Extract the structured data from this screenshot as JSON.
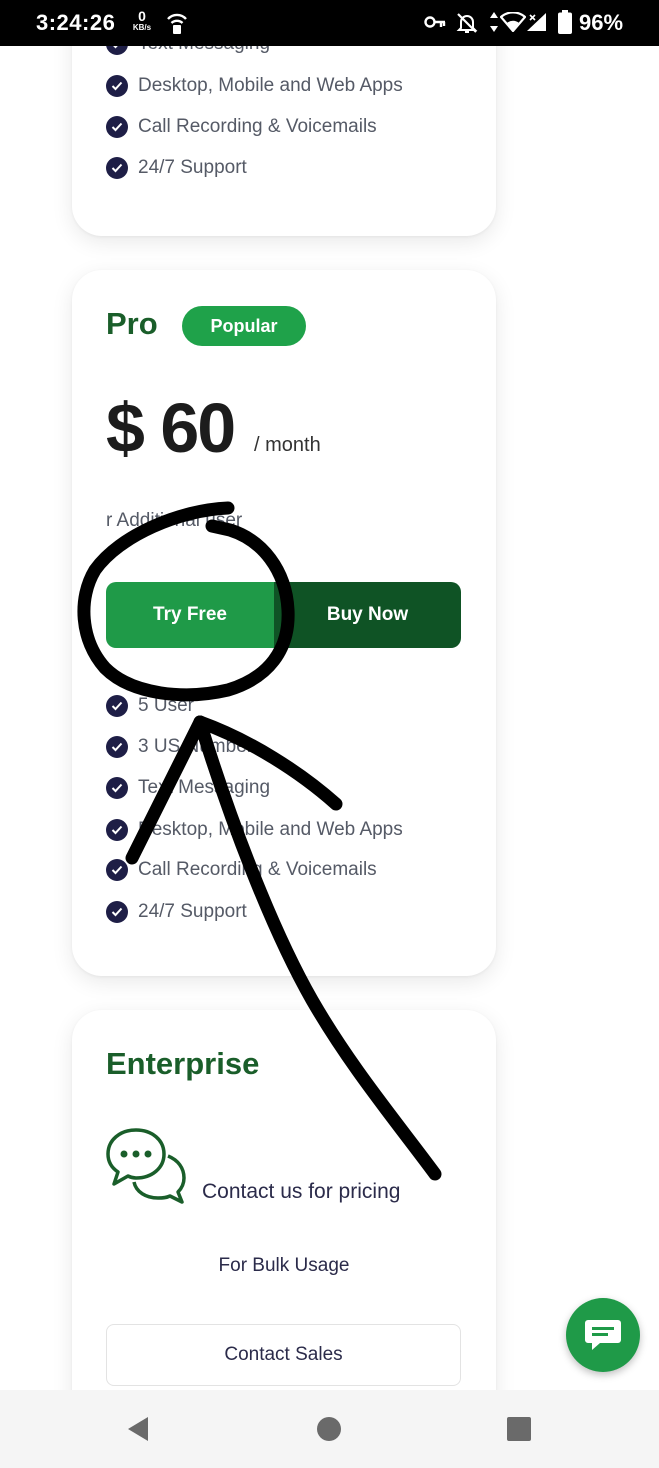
{
  "status_bar": {
    "time": "3:24:26",
    "network_speed_value": "0",
    "network_speed_unit": "KB/s",
    "battery": "96%",
    "icons": [
      "hotspot-icon",
      "vpn-key-icon",
      "notifications-off-icon",
      "wifi-icon",
      "signal-icon",
      "battery-icon"
    ]
  },
  "basic_plan": {
    "features": [
      "Text Messaging",
      "Desktop, Mobile and Web Apps",
      "Call Recording & Voicemails",
      "24/7 Support"
    ]
  },
  "pro_plan": {
    "title": "Pro",
    "badge": "Popular",
    "price": "$ 60",
    "period": "/ month",
    "additional_user": "r Additional user",
    "try_button": "Try Free",
    "buy_button": "Buy Now",
    "features": [
      "5 User",
      "3 US Number",
      "Text Messaging",
      "Desktop, Mobile and Web Apps",
      "Call Recording & Voicemails",
      "24/7 Support"
    ]
  },
  "enterprise_plan": {
    "title": "Enterprise",
    "contact_text": "Contact us for pricing",
    "bulk_text": "For Bulk Usage",
    "contact_button": "Contact Sales"
  },
  "colors": {
    "brand_green": "#1f9a48",
    "dark_green": "#0f5325",
    "title_green": "#1a5e2a",
    "check_navy": "#1e1e46",
    "annotation_ink": "#000000"
  }
}
